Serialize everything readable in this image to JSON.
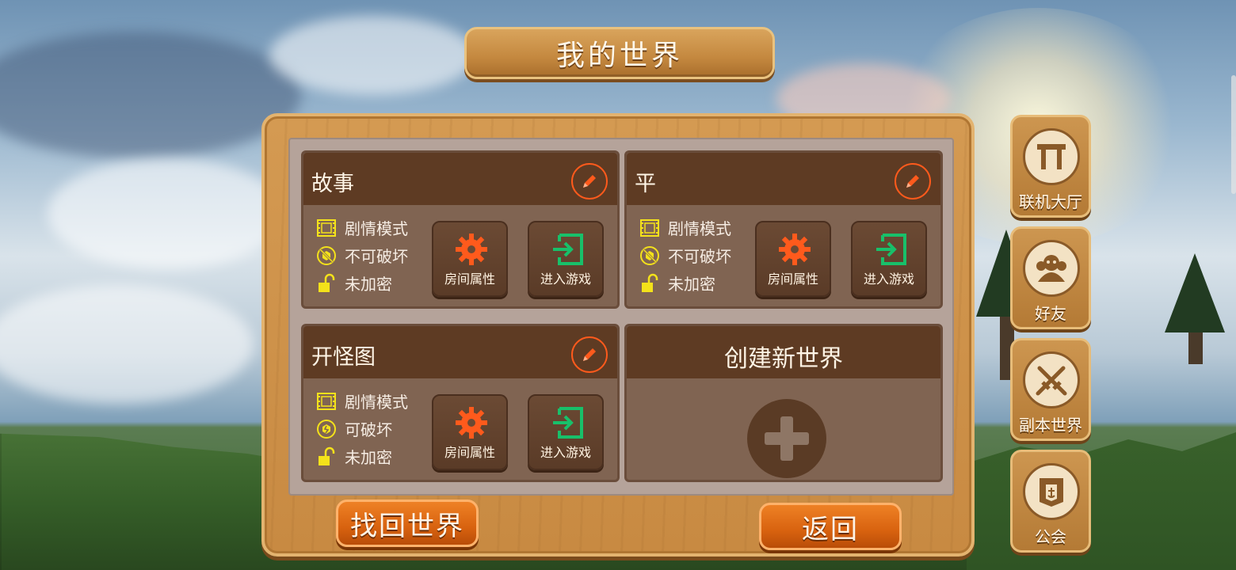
{
  "header": {
    "title": "我的世界"
  },
  "worlds": [
    {
      "name": "故事",
      "attributes": [
        {
          "icon": "film-icon",
          "label": "剧情模式"
        },
        {
          "icon": "indestructible-icon",
          "label": "不可破坏"
        },
        {
          "icon": "unlock-icon",
          "label": "未加密"
        }
      ],
      "room_button": "房间属性",
      "enter_button": "进入游戏"
    },
    {
      "name": "平",
      "attributes": [
        {
          "icon": "film-icon",
          "label": "剧情模式"
        },
        {
          "icon": "indestructible-icon",
          "label": "不可破坏"
        },
        {
          "icon": "unlock-icon",
          "label": "未加密"
        }
      ],
      "room_button": "房间属性",
      "enter_button": "进入游戏"
    },
    {
      "name": "开怪图",
      "attributes": [
        {
          "icon": "film-icon",
          "label": "剧情模式"
        },
        {
          "icon": "destructible-icon",
          "label": "可破坏"
        },
        {
          "icon": "unlock-icon",
          "label": "未加密"
        }
      ],
      "room_button": "房间属性",
      "enter_button": "进入游戏"
    }
  ],
  "create_world": {
    "label": "创建新世界"
  },
  "footer": {
    "recover_label": "找回世界",
    "back_label": "返回"
  },
  "sidebar": {
    "items": [
      {
        "label": "联机大厅",
        "icon": "lobby-gate-icon"
      },
      {
        "label": "好友",
        "icon": "friends-icon"
      },
      {
        "label": "副本世界",
        "icon": "crossed-swords-icon"
      },
      {
        "label": "公会",
        "icon": "guild-banner-icon"
      }
    ]
  },
  "colors": {
    "accent_orange": "#ff5a1c",
    "enter_green": "#18c06a",
    "lock_yellow": "#f4e21a",
    "card_header": "#5e3b23",
    "card_body": "#806452"
  }
}
